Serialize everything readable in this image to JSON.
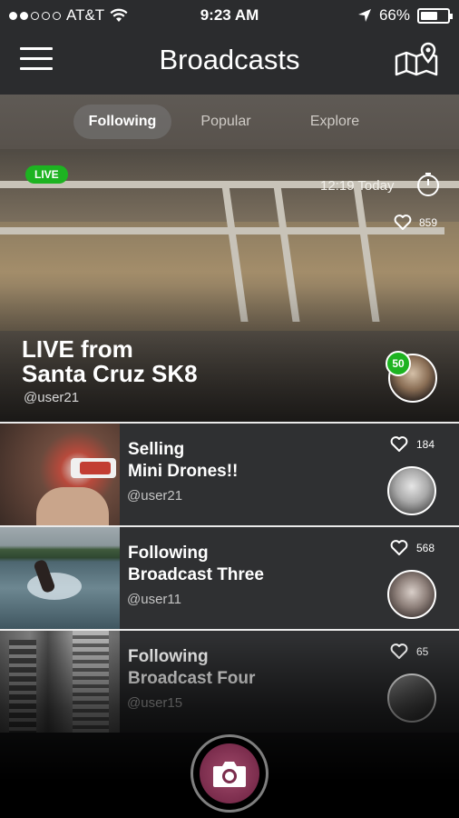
{
  "status_bar": {
    "carrier": "AT&T",
    "time": "9:23 AM",
    "battery": "66%",
    "battery_level": 0.66
  },
  "header": {
    "title": "Broadcasts",
    "menu_icon": "hamburger-menu-icon",
    "map_icon": "map-pin-icon"
  },
  "tabs": [
    {
      "label": "Following",
      "active": true
    },
    {
      "label": "Popular",
      "active": false
    },
    {
      "label": "Explore",
      "active": false
    }
  ],
  "featured": {
    "live_label": "LIVE",
    "time": "12:19 Today",
    "likes": "859",
    "title_line1": "LIVE from",
    "title_line2": "Santa Cruz SK8",
    "user": "@user21",
    "viewer_count": "50"
  },
  "broadcasts": [
    {
      "title_line1": "Selling",
      "title_line2": "Mini Drones!!",
      "user": "@user21",
      "likes": "184"
    },
    {
      "title_line1": "Following",
      "title_line2": "Broadcast Three",
      "user": "@user11",
      "likes": "568"
    },
    {
      "title_line1": "Following",
      "title_line2": "Broadcast Four",
      "user": "@user15",
      "likes": "65"
    }
  ],
  "colors": {
    "live_green": "#1db321",
    "header_bg": "#2b2c2e",
    "camera_accent": "#7a2c4c"
  },
  "camera_icon": "camera-icon"
}
